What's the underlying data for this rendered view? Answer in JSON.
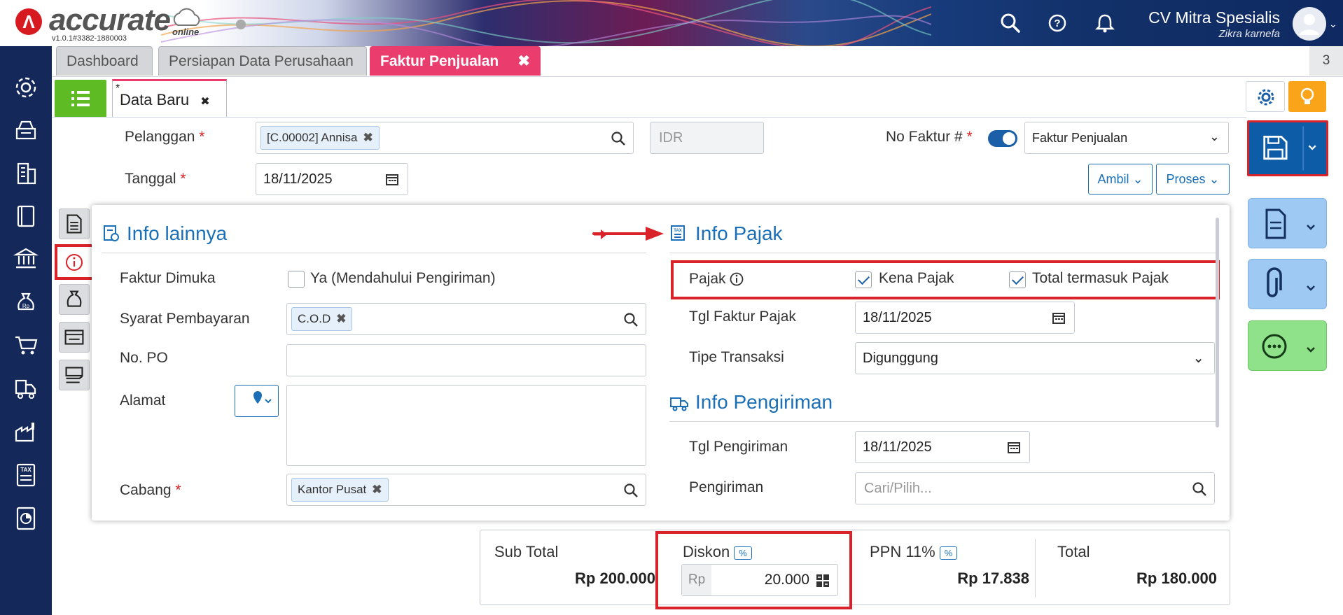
{
  "header": {
    "brand": "accurate",
    "brand_sub": "online",
    "version": "v1.0.1#3382-1880003",
    "company": "CV Mitra Spesialis",
    "user": "Zikra karnefa",
    "icons": [
      "search-icon",
      "help-icon",
      "bell-icon",
      "avatar"
    ]
  },
  "nav_icons": [
    "settings-icon",
    "inventory-icon",
    "building-icon",
    "book-icon",
    "bank-icon",
    "money-bag-icon",
    "cart-icon",
    "truck-icon",
    "factory-icon",
    "tax-icon",
    "report-icon"
  ],
  "tabs": [
    {
      "label": "Dashboard"
    },
    {
      "label": "Persiapan Data Perusahaan"
    },
    {
      "label": "Faktur Penjualan",
      "close": "✖"
    }
  ],
  "tab_count": "3",
  "subtab": {
    "star": "*",
    "label": "Data Baru",
    "close": "✖"
  },
  "form": {
    "pelanggan_label": "Pelanggan",
    "pelanggan_chip": "[C.00002] Annisa",
    "currency": "IDR",
    "no_faktur_label": "No Faktur #",
    "faktur_type": "Faktur Penjualan",
    "tanggal_label": "Tanggal",
    "tanggal_value": "18/11/2025",
    "ambil_label": "Ambil",
    "proses_label": "Proses",
    "required_mark": "*"
  },
  "info_lainnya": {
    "title": "Info lainnya",
    "faktur_dimuka_label": "Faktur Dimuka",
    "faktur_dimuka_option": "Ya (Mendahului Pengiriman)",
    "syarat_label": "Syarat Pembayaran",
    "syarat_chip": "C.O.D",
    "po_label": "No. PO",
    "alamat_label": "Alamat",
    "cabang_label": "Cabang",
    "cabang_chip": "Kantor Pusat"
  },
  "info_pajak": {
    "title": "Info Pajak",
    "pajak_label": "Pajak",
    "kena_pajak": "Kena Pajak",
    "total_termasuk": "Total termasuk Pajak",
    "tgl_faktur_label": "Tgl Faktur Pajak",
    "tgl_faktur_value": "18/11/2025",
    "tipe_label": "Tipe Transaksi",
    "tipe_value": "Digunggung"
  },
  "info_pengiriman": {
    "title": "Info Pengiriman",
    "tgl_label": "Tgl Pengiriman",
    "tgl_value": "18/11/2025",
    "pengiriman_label": "Pengiriman",
    "pengiriman_placeholder": "Cari/Pilih..."
  },
  "totals": {
    "subtotal_label": "Sub Total",
    "subtotal_value": "Rp 200.000",
    "diskon_label": "Diskon",
    "pct": "%",
    "diskon_prefix": "Rp",
    "diskon_value": "20.000",
    "ppn_label": "PPN 11%",
    "ppn_value": "Rp 17.838",
    "total_label": "Total",
    "total_value": "Rp 180.000"
  },
  "colors": {
    "accent": "#1a6fb6",
    "tab_active": "#ea3d6e",
    "highlight": "#d9222a",
    "nav": "#15285a",
    "list_btn": "#5fbb24",
    "bulb_btn": "#f9a419"
  }
}
